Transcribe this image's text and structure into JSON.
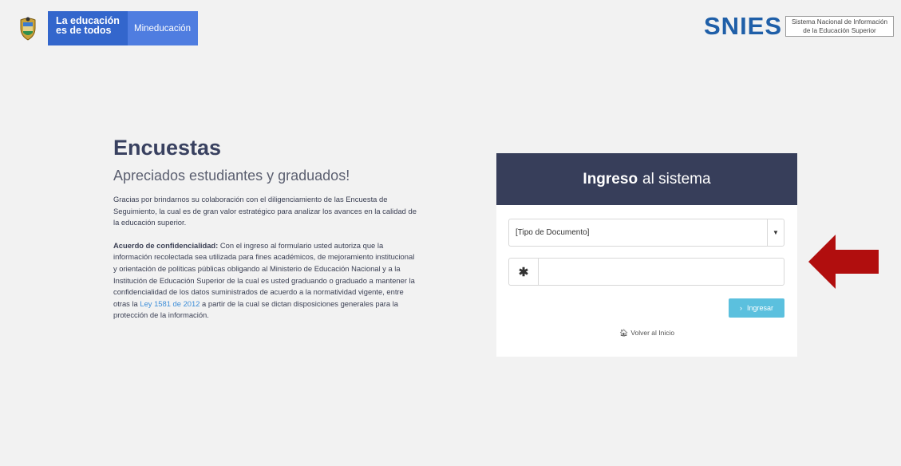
{
  "header": {
    "brand_line1": "La educación",
    "brand_line2": "es de todos",
    "ministry": "Mineducación",
    "snies": "SNIES",
    "snies_line1": "Sistema Nacional de Información",
    "snies_line2": "de la Educación Superior"
  },
  "intro": {
    "title": "Encuestas",
    "subtitle": "Apreciados estudiantes y graduados!",
    "paragraph1": "Gracias por brindarnos su colaboración con el diligenciamiento de las Encuesta de Seguimiento, la cual es de gran valor estratégico para analizar los avances en la calidad de la educación superior.",
    "confidential_label": "Acuerdo de confidencialidad:",
    "paragraph2_part1": " Con el ingreso al formulario usted autoriza que la información recolectada sea utilizada para fines académicos, de mejoramiento institucional y orientación de políticas públicas obligando al Ministerio de Educación Nacional y a la Institución de Educación Superior de la cual es usted graduando o graduado a mantener la confidencialidad de los datos suministrados de acuerdo a la normatividad vigente, entre otras la ",
    "law_link": "Ley 1581 de 2012",
    "paragraph2_part2": " a partir de la cual se dictan disposiciones generales para la protección de la información."
  },
  "login": {
    "title_strong": "Ingreso",
    "title_rest": "al sistema",
    "doc_type_selected": "[Tipo de Documento]",
    "doc_number_value": "",
    "submit_label": "Ingresar",
    "back_label": "Volver al Inicio"
  },
  "colors": {
    "card_header": "#373e5a",
    "brand_blue": "#3366cc",
    "button": "#5bc0de",
    "arrow": "#b10e0e"
  }
}
